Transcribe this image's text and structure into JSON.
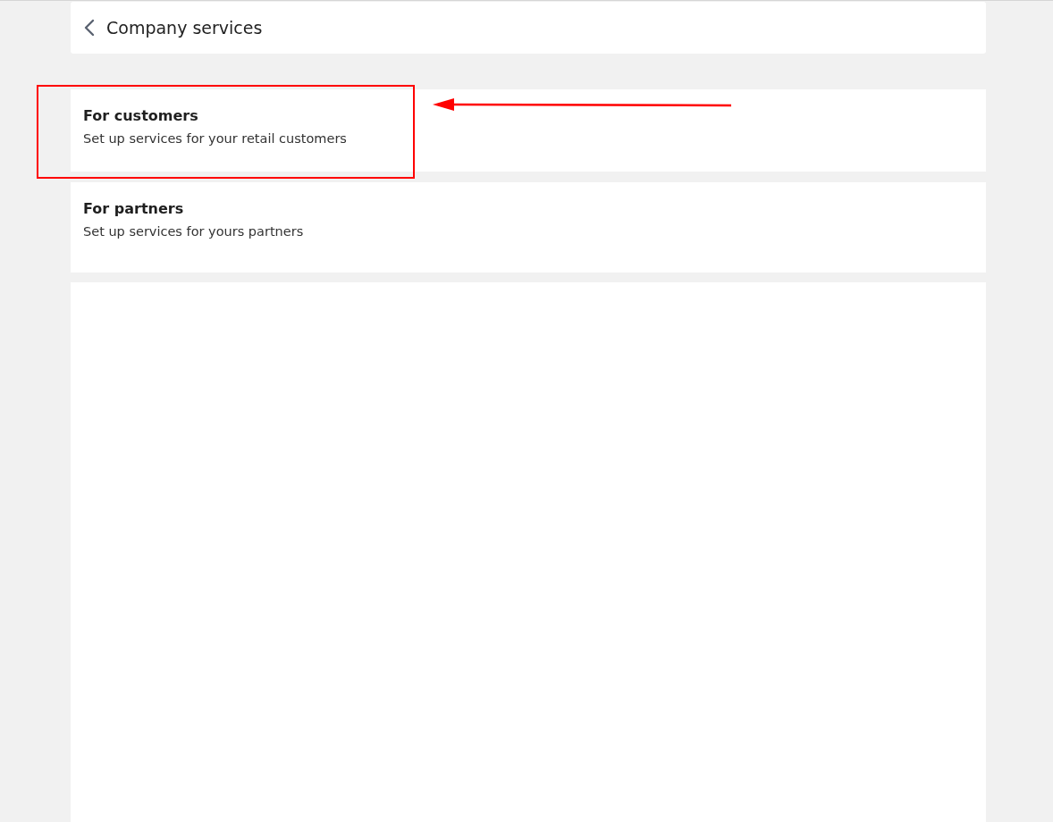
{
  "header": {
    "title": "Company services"
  },
  "options": [
    {
      "title": "For customers",
      "description": "Set up services for your retail customers",
      "highlighted": true
    },
    {
      "title": "For partners",
      "description": "Set up services for yours partners",
      "highlighted": false
    }
  ]
}
